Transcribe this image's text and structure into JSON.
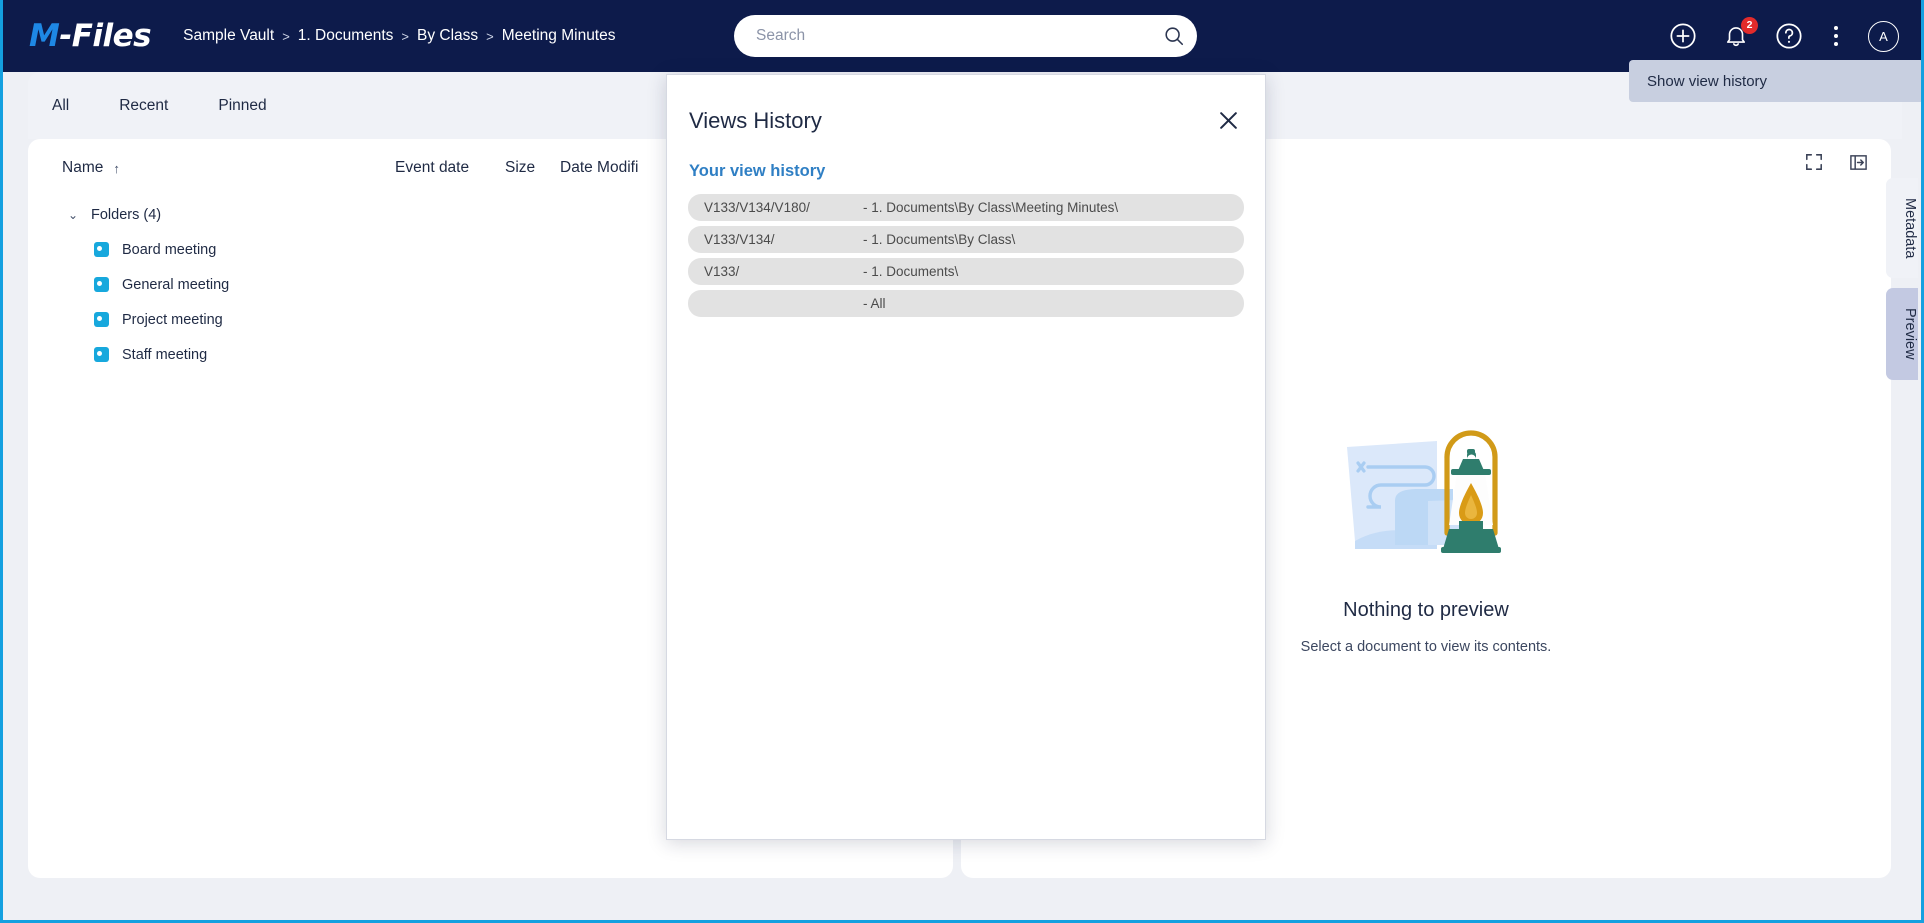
{
  "app": {
    "brand_name_m": "M",
    "brand_name_rest": "-Files",
    "accent_blue": "#14a0e0",
    "header_bg": "#0d1b4b",
    "link_blue": "#2f7fc4"
  },
  "breadcrumb": {
    "items": [
      "Sample Vault",
      "1. Documents",
      "By Class",
      "Meeting Minutes"
    ],
    "separator": ">"
  },
  "search": {
    "placeholder": "Search",
    "value": "",
    "icon": "search-icon"
  },
  "header_icons": {
    "create": "plus-circle-icon",
    "notifications": "bell-icon",
    "notification_count": "2",
    "help": "question-circle-icon",
    "more": "more-vertical-icon",
    "avatar_initial": "A"
  },
  "tooltip": {
    "label": "Show view history"
  },
  "tabs": [
    {
      "label": "All",
      "active": true
    },
    {
      "label": "Recent",
      "active": false
    },
    {
      "label": "Pinned",
      "active": false
    }
  ],
  "list": {
    "columns": {
      "name": "Name",
      "sort_indicator": "↑",
      "event_date": "Event date",
      "size": "Size",
      "date_modified": "Date Modifi"
    },
    "group": {
      "label": "Folders (4)",
      "chevron": "chevron-down-icon"
    },
    "rows": [
      {
        "name": "Board meeting",
        "icon": "class-tag-icon"
      },
      {
        "name": "General meeting",
        "icon": "class-tag-icon"
      },
      {
        "name": "Project meeting",
        "icon": "class-tag-icon"
      },
      {
        "name": "Staff meeting",
        "icon": "class-tag-icon"
      }
    ]
  },
  "preview": {
    "tools": {
      "fullscreen": "fullscreen-icon",
      "collapse_panel": "collapse-panel-icon"
    },
    "empty_title": "Nothing to preview",
    "empty_subtitle": "Select a document to view its contents.",
    "illustration": "lantern-and-document-illustration"
  },
  "side_tabs": [
    {
      "label": "Metadata",
      "selected": false
    },
    {
      "label": "Preview",
      "selected": true
    }
  ],
  "modal": {
    "title": "Views History",
    "close_icon": "close-icon",
    "section_title": "Your view history",
    "rows": [
      {
        "key": "V133/V134/V180/",
        "path": "- 1. Documents\\By Class\\Meeting Minutes\\"
      },
      {
        "key": "V133/V134/",
        "path": "- 1. Documents\\By Class\\"
      },
      {
        "key": "V133/",
        "path": "- 1. Documents\\"
      },
      {
        "key": "",
        "path": "- All"
      }
    ]
  }
}
